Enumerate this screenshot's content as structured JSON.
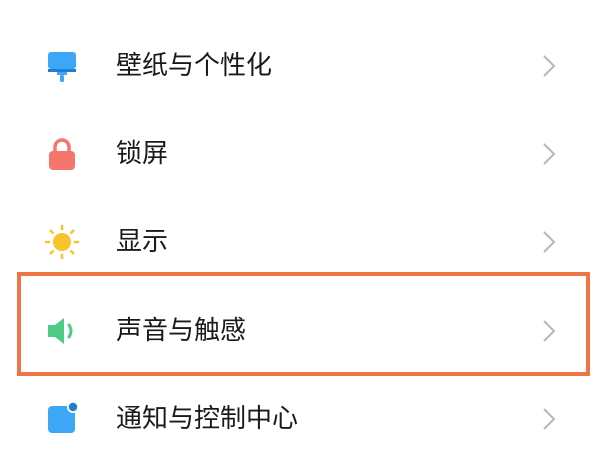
{
  "settings": {
    "items": [
      {
        "label": "壁纸与个性化",
        "icon": "paint-roller-icon",
        "color": "#3ea6f7"
      },
      {
        "label": "锁屏",
        "icon": "lock-icon",
        "color": "#f4766d"
      },
      {
        "label": "显示",
        "icon": "sun-icon",
        "color": "#f9c32b"
      },
      {
        "label": "声音与触感",
        "icon": "speaker-icon",
        "color": "#4dcc86"
      },
      {
        "label": "通知与控制中心",
        "icon": "notification-icon",
        "color": "#3ea6f7"
      }
    ],
    "highlighted_item_label": "声音与触感",
    "highlight_color": "#ef7546",
    "chevron_color": "#b8b8b8"
  }
}
